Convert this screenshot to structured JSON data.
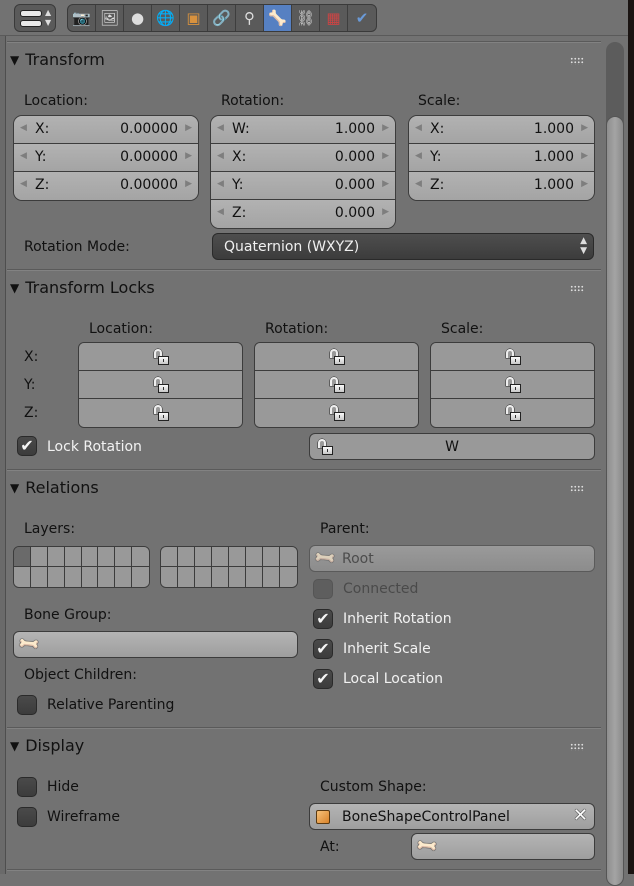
{
  "header": {
    "context_button": {
      "icon": "context-toggle-icon"
    },
    "tabs": [
      {
        "name": "render",
        "icon": "camera-icon",
        "glyph": "📷",
        "active": false
      },
      {
        "name": "render-layers",
        "icon": "image-layers-icon",
        "glyph": "🖼",
        "active": false
      },
      {
        "name": "scene",
        "icon": "scene-icon",
        "glyph": "●",
        "active": false
      },
      {
        "name": "world",
        "icon": "world-icon",
        "glyph": "🌐",
        "active": false
      },
      {
        "name": "object",
        "icon": "cube-icon",
        "glyph": "▣",
        "active": false
      },
      {
        "name": "constraints",
        "icon": "link-icon",
        "glyph": "🔗",
        "active": false
      },
      {
        "name": "object-data",
        "icon": "armature-icon",
        "glyph": "⚲",
        "active": false
      },
      {
        "name": "bone",
        "icon": "bone-icon",
        "glyph": "🦴",
        "active": true
      },
      {
        "name": "bone-constraints",
        "icon": "bone-constraint-icon",
        "glyph": "⛓",
        "active": false
      },
      {
        "name": "texture",
        "icon": "checker-texture-icon",
        "glyph": "▦",
        "active": false
      },
      {
        "name": "physics",
        "icon": "physics-icon",
        "glyph": "✔",
        "active": false
      }
    ]
  },
  "transform": {
    "title": "Transform",
    "location": {
      "label": "Location:",
      "fields": [
        {
          "name": "X:",
          "value": "0.00000"
        },
        {
          "name": "Y:",
          "value": "0.00000"
        },
        {
          "name": "Z:",
          "value": "0.00000"
        }
      ]
    },
    "rotation": {
      "label": "Rotation:",
      "fields": [
        {
          "name": "W:",
          "value": "1.000"
        },
        {
          "name": "X:",
          "value": "0.000"
        },
        {
          "name": "Y:",
          "value": "0.000"
        },
        {
          "name": "Z:",
          "value": "0.000"
        }
      ]
    },
    "scale": {
      "label": "Scale:",
      "fields": [
        {
          "name": "X:",
          "value": "1.000"
        },
        {
          "name": "Y:",
          "value": "1.000"
        },
        {
          "name": "Z:",
          "value": "1.000"
        }
      ]
    },
    "rotation_mode_label": "Rotation Mode:",
    "rotation_mode_value": "Quaternion (WXYZ)"
  },
  "transform_locks": {
    "title": "Transform Locks",
    "col_location": "Location:",
    "col_rotation": "Rotation:",
    "col_scale": "Scale:",
    "rows": [
      "X:",
      "Y:",
      "Z:"
    ],
    "lock_rotation_label": "Lock Rotation",
    "lock_rotation_checked": true,
    "w_label": "W"
  },
  "relations": {
    "title": "Relations",
    "layers_label": "Layers:",
    "active_layers": [
      0
    ],
    "parent_label": "Parent:",
    "parent_value": "Root",
    "connected_label": "Connected",
    "connected_checked": false,
    "inherit_rotation_label": "Inherit Rotation",
    "inherit_rotation_checked": true,
    "inherit_scale_label": "Inherit Scale",
    "inherit_scale_checked": true,
    "local_location_label": "Local Location",
    "local_location_checked": true,
    "bone_group_label": "Bone Group:",
    "bone_group_value": "",
    "object_children_label": "Object Children:",
    "relative_parenting_label": "Relative Parenting",
    "relative_parenting_checked": false
  },
  "display": {
    "title": "Display",
    "hide_label": "Hide",
    "hide_checked": false,
    "wireframe_label": "Wireframe",
    "wireframe_checked": false,
    "custom_shape_label": "Custom Shape:",
    "custom_shape_value": "BoneShapeControlPanel",
    "at_label": "At:",
    "at_value": ""
  },
  "icons": {
    "triangle": "▼",
    "check": "✔",
    "arrow_left": "◀",
    "arrow_right": "▶",
    "updown": "▲▼",
    "clear": "✕",
    "bone": "🦴"
  }
}
